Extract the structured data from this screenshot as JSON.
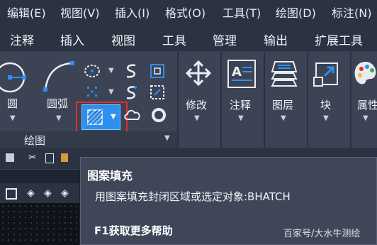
{
  "menubar": {
    "items": [
      "编辑(E)",
      "视图(V)",
      "插入(I)",
      "格式(O)",
      "工具(T)",
      "绘图(D)",
      "标注(N)"
    ]
  },
  "ribbon_tabs": [
    "注释",
    "插入",
    "视图",
    "工具",
    "管理",
    "输出",
    "扩展工具"
  ],
  "ribbon": {
    "circle_label": "圆",
    "arc_label": "圆弧",
    "modify_label": "修改",
    "annotate_label": "注释",
    "layers_label": "图层",
    "block_label": "块",
    "properties_label": "属性",
    "draw_group_title": "绘图"
  },
  "tooltip": {
    "title": "图案填充",
    "description": "用图案填充封闭区域或选定对象:BHATCH",
    "help": "F1获取更多帮助"
  },
  "watermark": "百家号/大水牛测绘",
  "colors": {
    "menubar_bg": "#2b3242",
    "ribbon_bg": "#3b4354",
    "accent_blue": "#2e8ff0",
    "highlight_red": "#e0302c"
  }
}
